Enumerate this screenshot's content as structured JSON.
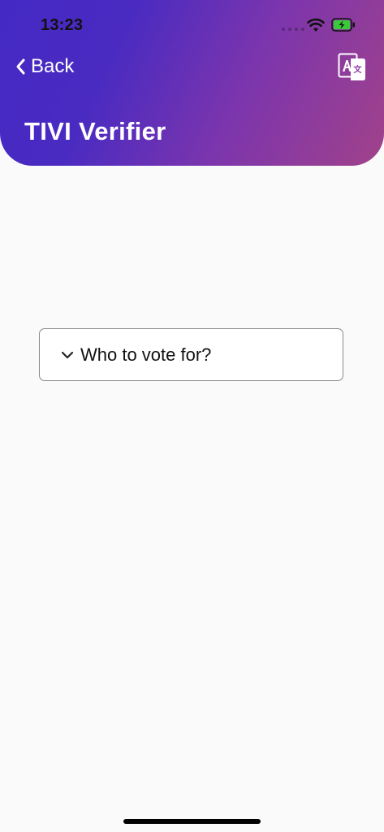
{
  "status_bar": {
    "time": "13:23"
  },
  "nav": {
    "back_label": "Back",
    "translate_icon": "translate-icon"
  },
  "header": {
    "title": "TIVI Verifier"
  },
  "accordion": {
    "label": "Who to vote for?",
    "expanded": false
  },
  "colors": {
    "gradient_start": "#4429c4",
    "gradient_end": "#a1428a",
    "background": "#fafafa"
  }
}
